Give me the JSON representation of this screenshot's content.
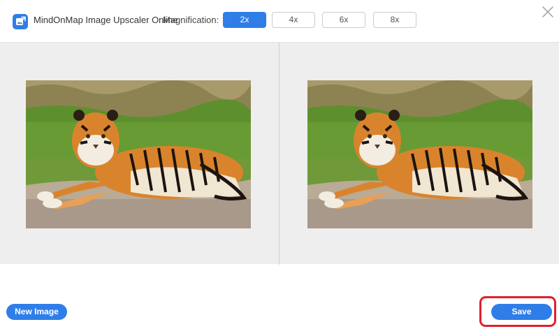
{
  "header": {
    "app_title": "MindOnMap Image Upscaler Online",
    "app_icon": "image-upscale-icon",
    "magnification_label": "Magnification:",
    "magnification_options": [
      "2x",
      "4x",
      "6x",
      "8x"
    ],
    "selected_option": "2x",
    "close_icon": "close-icon"
  },
  "previews": {
    "original_image": "tiger-lying-on-grass-photo",
    "upscaled_image": "tiger-lying-on-grass-photo"
  },
  "footer": {
    "new_image_label": "New Image",
    "save_label": "Save"
  },
  "colors": {
    "accent": "#2f7ee8",
    "highlight": "#e0202a",
    "panel_background": "#eeeeee"
  }
}
